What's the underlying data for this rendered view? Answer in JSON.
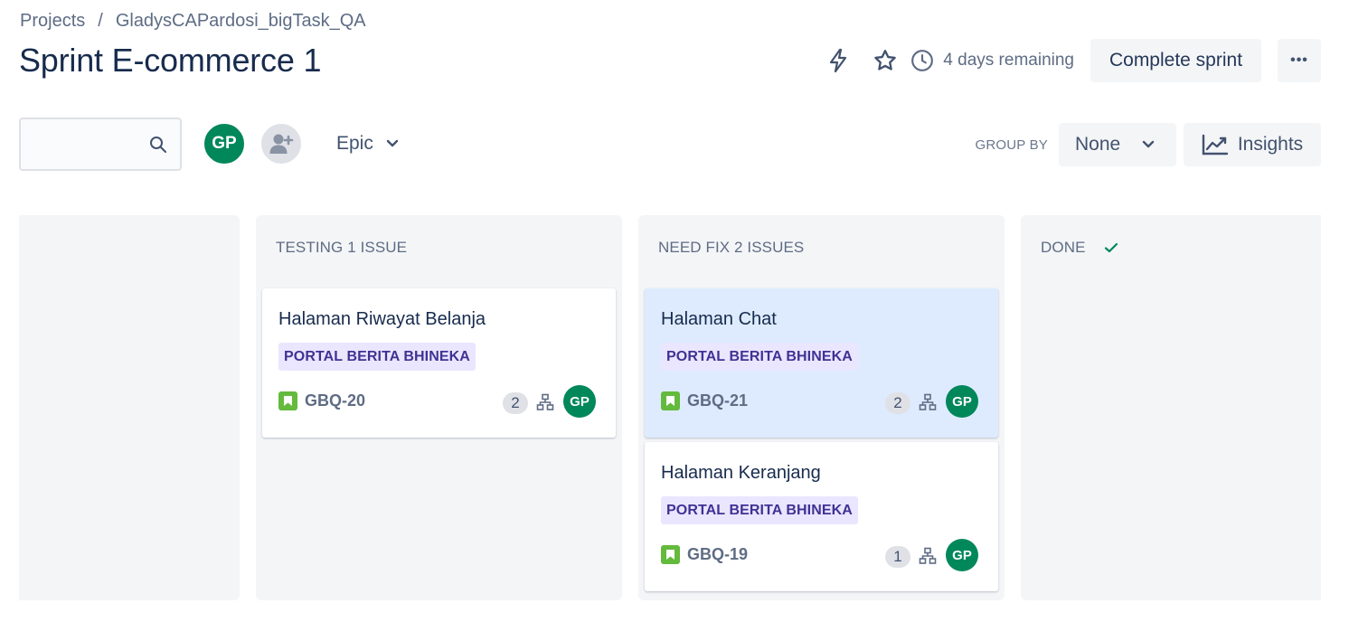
{
  "breadcrumb": {
    "items": [
      "Projects",
      "GladysCAPardosi_bigTask_QA"
    ],
    "separator": "/"
  },
  "page_title": "Sprint E-commerce 1",
  "header": {
    "time_remaining": "4 days remaining",
    "complete_sprint_label": "Complete sprint",
    "more_label": "•••"
  },
  "toolbar": {
    "search_value": "",
    "avatar_initials": "GP",
    "epic_filter_label": "Epic",
    "group_by_label": "GROUP BY",
    "group_by_value": "None",
    "insights_label": "Insights"
  },
  "columns": [
    {
      "title": "",
      "cards": []
    },
    {
      "title": "TESTING 1 ISSUE",
      "cards": [
        {
          "title": "Halaman Riwayat Belanja",
          "epic": "PORTAL BERITA BHINEKA",
          "key": "GBQ-20",
          "estimate": "2",
          "assignee": "GP"
        }
      ]
    },
    {
      "title": "NEED FIX 2 ISSUES",
      "cards": [
        {
          "title": "Halaman Chat",
          "epic": "PORTAL BERITA BHINEKA",
          "key": "GBQ-21",
          "estimate": "2",
          "assignee": "GP"
        },
        {
          "title": "Halaman Keranjang",
          "epic": "PORTAL BERITA BHINEKA",
          "key": "GBQ-19",
          "estimate": "1",
          "assignee": "GP"
        }
      ]
    },
    {
      "title": "DONE",
      "cards": []
    }
  ],
  "colors": {
    "avatar": "#00875a",
    "epic_bg": "#eae6ff",
    "epic_text": "#403294",
    "story": "#63ba3c",
    "selected_card": "#deebff",
    "done_check": "#00875a"
  }
}
